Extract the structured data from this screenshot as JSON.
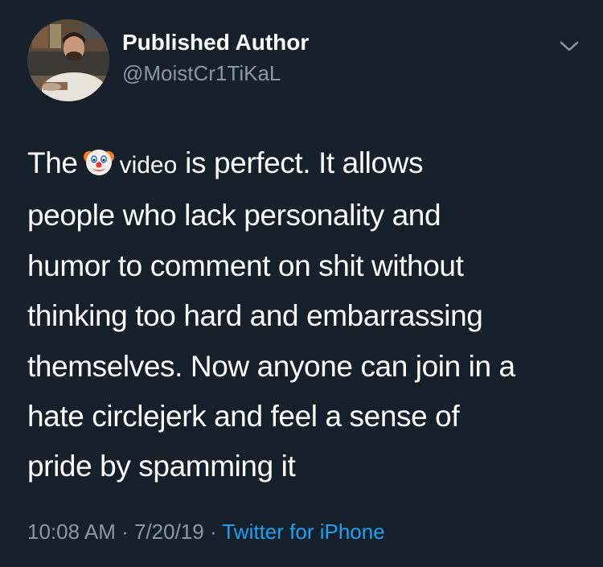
{
  "author": {
    "display_name": "Published Author",
    "handle": "@MoistCr1TiKaL"
  },
  "tweet": {
    "word_before_emoji": "The",
    "emoji": "clown-face",
    "word_after_emoji": "video",
    "line1_rest": "is perfect. It allows",
    "line2": "people who lack personality and",
    "line3": "humor to comment on shit without",
    "line4": "thinking too hard and embarrassing",
    "line5": "themselves. Now anyone can join in a",
    "line6": "hate circlejerk and feel a sense of",
    "line7": "pride by spamming it"
  },
  "meta": {
    "time": "10:08 AM",
    "separator1": " · ",
    "date": "7/20/19",
    "separator2": " · ",
    "source": "Twitter for iPhone"
  },
  "colors": {
    "background": "#15202b",
    "primary_text": "#ffffff",
    "secondary_text": "#8899a6",
    "link": "#1da1f2"
  },
  "icons": {
    "avatar": "profile-photo",
    "menu": "chevron-down-icon",
    "emoji": "clown-face-icon"
  }
}
